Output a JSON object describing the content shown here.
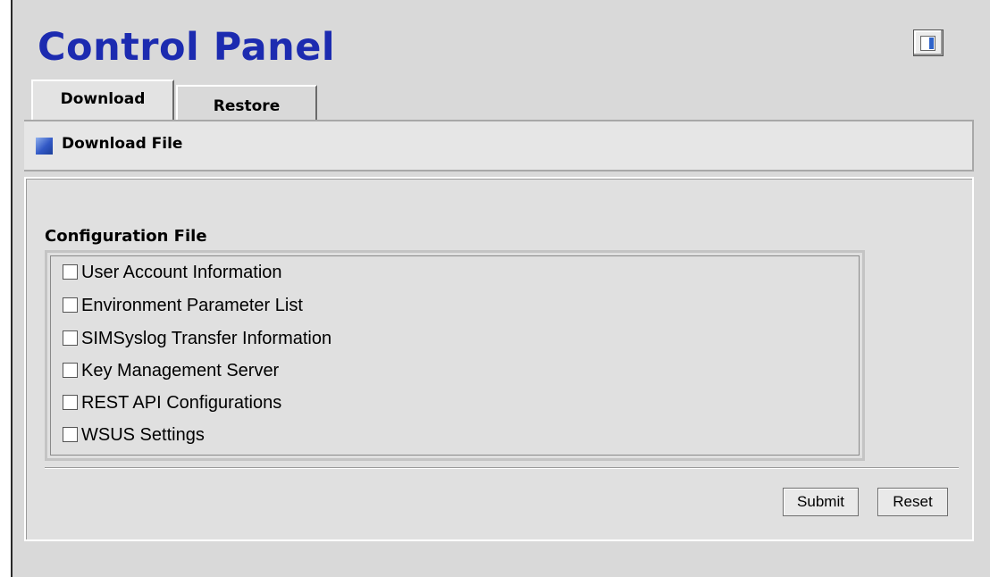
{
  "header": {
    "title": "Control Panel",
    "logout_icon": "logout-door-icon"
  },
  "tabs": [
    {
      "label": "Download",
      "active": true
    },
    {
      "label": "Restore",
      "active": false
    }
  ],
  "section": {
    "title": "Download File",
    "icon": "blue-square-icon",
    "icon_color": "#3158c5"
  },
  "form": {
    "group_label": "Configuration File",
    "options": [
      {
        "label": "User Account Information",
        "checked": false
      },
      {
        "label": "Environment Parameter List",
        "checked": false
      },
      {
        "label": "SIMSyslog Transfer Information",
        "checked": false
      },
      {
        "label": "Key Management Server",
        "checked": false
      },
      {
        "label": "REST API Configurations",
        "checked": false
      },
      {
        "label": "WSUS Settings",
        "checked": false
      }
    ],
    "submit_label": "Submit",
    "reset_label": "Reset"
  },
  "colors": {
    "title": "#1c2bb0",
    "background": "#d9d9d9"
  }
}
